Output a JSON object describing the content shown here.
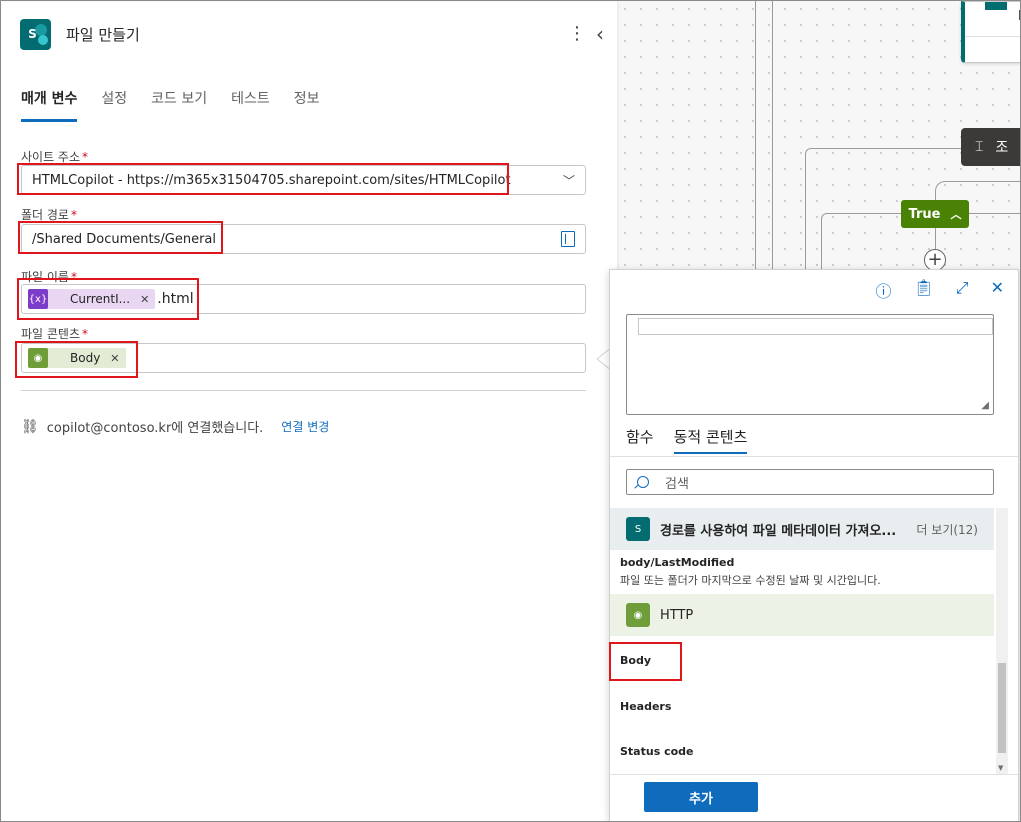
{
  "panel": {
    "title": "파일 만들기",
    "logo_letter": "S",
    "more_glyph": "⋮",
    "collapse_glyph": "‹"
  },
  "tabs": [
    {
      "label": "매개 변수",
      "active": true
    },
    {
      "label": "설정"
    },
    {
      "label": "코드 보기"
    },
    {
      "label": "테스트"
    },
    {
      "label": "정보"
    }
  ],
  "fields": {
    "site": {
      "label": "사이트 주소",
      "value": "HTMLCopilot - https://m365x31504705.sharepoint.com/sites/HTMLCopilot"
    },
    "folder": {
      "label": "폴더 경로",
      "value": "/Shared Documents/General"
    },
    "filename": {
      "label": "파일 이름",
      "token": "CurrentI...",
      "suffix": ".html"
    },
    "content": {
      "label": "파일 콘텐츠",
      "token": "Body"
    },
    "required_mark": "*"
  },
  "connection": {
    "text": "copilot@contoso.kr에 연결했습니다.",
    "change_label": "연결 변경"
  },
  "canvas": {
    "condition_label": "조",
    "true_label": "True",
    "plus": "+"
  },
  "popup": {
    "tabs": [
      {
        "label": "함수"
      },
      {
        "label": "동적 콘텐츠",
        "active": true
      }
    ],
    "search_placeholder": "검색",
    "groups": [
      {
        "name": "경로를 사용하여 파일 메타데이터 가져오...",
        "more": "더 보기(12)",
        "items": [
          {
            "name": "body/LastModified",
            "desc": "파일 또는 폴더가 마지막으로 수정된 날짜 및 시간입니다."
          }
        ]
      },
      {
        "name": "HTTP",
        "items": [
          {
            "name": "Body"
          },
          {
            "name": "Headers"
          },
          {
            "name": "Status code"
          }
        ]
      }
    ],
    "add_label": "추가"
  },
  "colors": {
    "accent": "#0f6cbd",
    "sharepoint": "#036c70",
    "http": "#6e9d3a",
    "expression": "#7c3bc9",
    "highlight": "#e0161b",
    "true_branch": "#498205"
  }
}
